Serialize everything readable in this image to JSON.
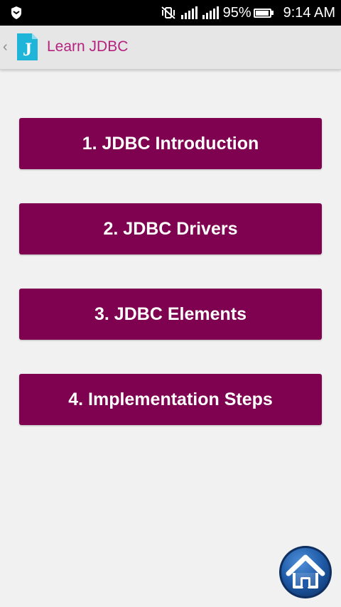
{
  "status_bar": {
    "battery": "95%",
    "battery_level": 0.95,
    "time": "9:14 AM",
    "icons": [
      "shield-icon",
      "mute-vibrate-icon",
      "signal-icon",
      "signal-icon",
      "battery-icon"
    ]
  },
  "app_bar": {
    "back_icon": "chevron-left-icon",
    "app_icon_letter": "J",
    "title": "Learn JDBC"
  },
  "menu": {
    "items": [
      {
        "label": "1. JDBC Introduction"
      },
      {
        "label": "2. JDBC Drivers"
      },
      {
        "label": "3. JDBC Elements"
      },
      {
        "label": "4. Implementation Steps"
      }
    ]
  },
  "home_button": {
    "icon": "home-icon"
  },
  "colors": {
    "button_bg": "#7e0250",
    "title_color": "#b5237f",
    "app_icon": "#1fb5d9",
    "home_fab": "#1f5ba8"
  }
}
